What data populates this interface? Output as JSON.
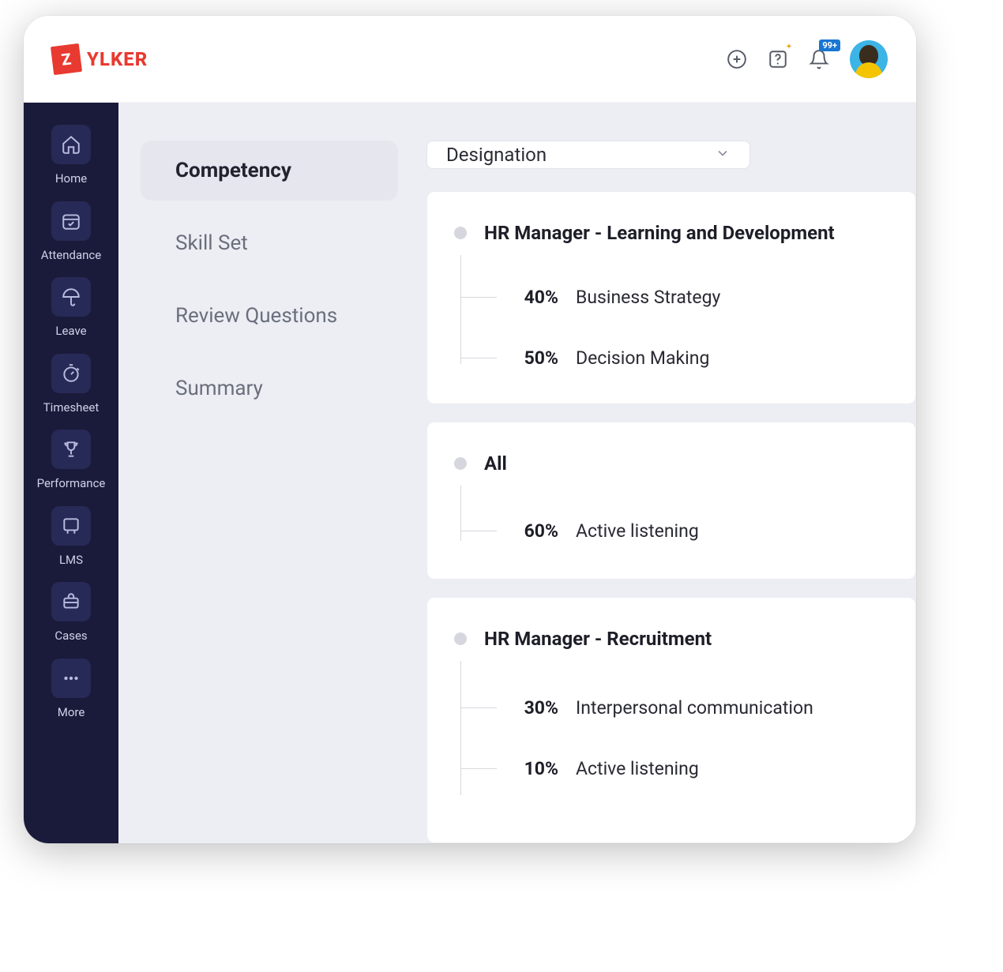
{
  "brand": {
    "badge_letter": "Z",
    "name": "YLKER"
  },
  "topbar": {
    "notification_badge": "99+"
  },
  "nav": {
    "items": [
      {
        "label": "Home"
      },
      {
        "label": "Attendance"
      },
      {
        "label": "Leave"
      },
      {
        "label": "Timesheet"
      },
      {
        "label": "Performance"
      },
      {
        "label": "LMS"
      },
      {
        "label": "Cases"
      },
      {
        "label": "More"
      }
    ]
  },
  "tabs": [
    {
      "label": "Competency",
      "active": true
    },
    {
      "label": "Skill Set"
    },
    {
      "label": "Review Questions"
    },
    {
      "label": "Summary"
    }
  ],
  "filter": {
    "label": "Designation"
  },
  "groups": [
    {
      "title": "HR Manager - Learning and Development",
      "items": [
        {
          "pct": "40%",
          "label": "Business Strategy"
        },
        {
          "pct": "50%",
          "label": "Decision Making"
        }
      ]
    },
    {
      "title": "All",
      "items": [
        {
          "pct": "60%",
          "label": "Active listening"
        }
      ]
    },
    {
      "title": "HR Manager - Recruitment",
      "items": [
        {
          "pct": "30%",
          "label": "Interpersonal communication"
        },
        {
          "pct": "10%",
          "label": "Active listening"
        }
      ]
    }
  ]
}
